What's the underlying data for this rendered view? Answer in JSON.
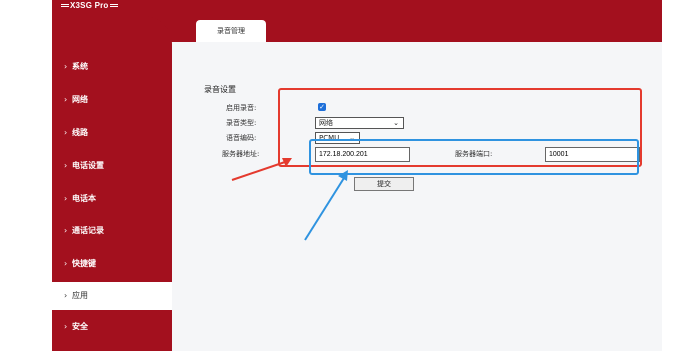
{
  "header": {
    "brand": "X3SG Pro"
  },
  "tabs": [
    {
      "label": "录音管理"
    }
  ],
  "sidebar": {
    "items": [
      {
        "label": "系统"
      },
      {
        "label": "网络"
      },
      {
        "label": "线路"
      },
      {
        "label": "电话设置"
      },
      {
        "label": "电话本"
      },
      {
        "label": "通话记录"
      },
      {
        "label": "快捷键"
      },
      {
        "label": "应用",
        "active": true
      },
      {
        "label": "安全"
      }
    ]
  },
  "form": {
    "section_title": "录音设置",
    "enable_label": "启用录音:",
    "enable_checked": true,
    "type_label": "录音类型:",
    "type_value": "网络",
    "codec_label": "语音编码:",
    "codec_value": "PCMU",
    "server_addr_label": "服务器地址:",
    "server_addr_value": "172.18.200.201",
    "server_port_label": "服务器端口:",
    "server_port_value": "10001",
    "submit_label": "提交"
  },
  "annotation_colors": {
    "red": "#e43a2e",
    "blue": "#2f93e0"
  }
}
